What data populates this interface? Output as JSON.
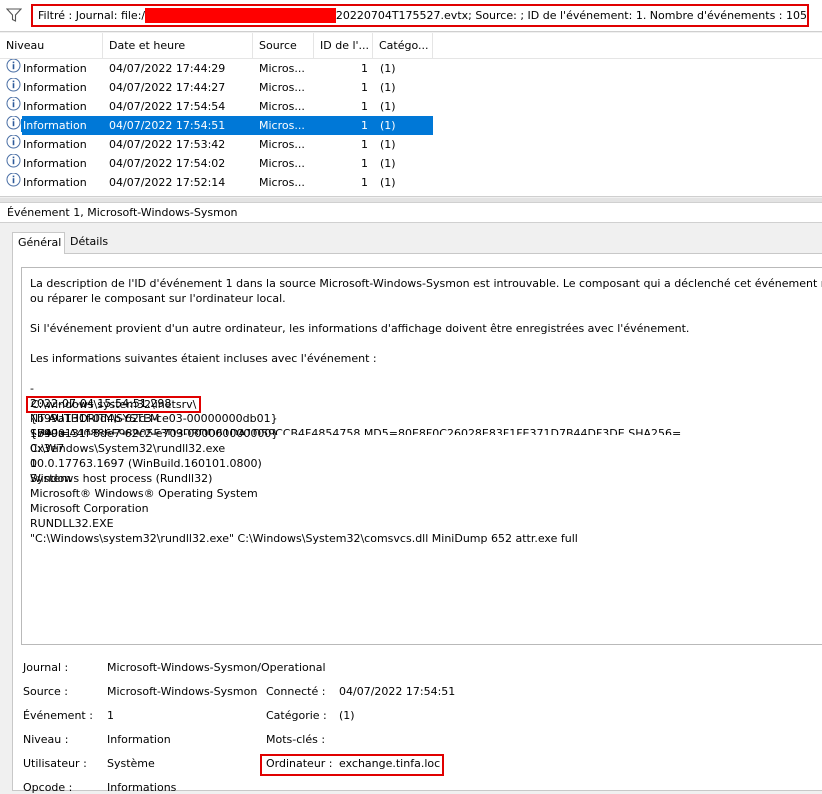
{
  "filter": {
    "prefix": "Filtré : Journal: file:/",
    "suffix": "20220704T175527.evtx; Source: ; ID de l'événement: 1. Nombre d'événements : 105"
  },
  "columns": {
    "level": "Niveau",
    "date": "Date et heure",
    "source": "Source",
    "id": "ID de l'...",
    "category": "Catégo..."
  },
  "rows": [
    {
      "level": "Information",
      "date": "04/07/2022 17:44:29",
      "source": "Micros...",
      "id": "1",
      "category": "(1)"
    },
    {
      "level": "Information",
      "date": "04/07/2022 17:44:27",
      "source": "Micros...",
      "id": "1",
      "category": "(1)"
    },
    {
      "level": "Information",
      "date": "04/07/2022 17:54:54",
      "source": "Micros...",
      "id": "1",
      "category": "(1)"
    },
    {
      "level": "Information",
      "date": "04/07/2022 17:54:51",
      "source": "Micros...",
      "id": "1",
      "category": "(1)"
    },
    {
      "level": "Information",
      "date": "04/07/2022 17:53:42",
      "source": "Micros...",
      "id": "1",
      "category": "(1)"
    },
    {
      "level": "Information",
      "date": "04/07/2022 17:54:02",
      "source": "Micros...",
      "id": "1",
      "category": "(1)"
    },
    {
      "level": "Information",
      "date": "04/07/2022 17:52:14",
      "source": "Micros...",
      "id": "1",
      "category": "(1)"
    }
  ],
  "selected_row": 3,
  "event_title": "Événement 1, Microsoft-Windows-Sysmon",
  "tabs": {
    "general": "Général",
    "details": "Détails"
  },
  "description": {
    "line1": "La description de l'ID d'événement 1 dans la source Microsoft-Windows-Sysmon est introuvable. Le composant qui a déclenché cet événement n'est pa",
    "line2": "ou réparer le composant sur l'ordinateur local.",
    "line3": "Si l'événement provient d'un autre ordinateur, les informations d'affichage doivent être enregistrées avec l'événement.",
    "line4": "Les informations suivantes étaient incluses avec l'événement :",
    "values": [
      "-",
      "2022-07-04 15:54:51.298",
      "{b99a131f-0d4b-62c3-ce03-00000000db01}",
      "17400",
      "C:\\Windows\\System32\\rundll32.exe",
      "10.0.17763.1697 (WinBuild.160101.0800)",
      "Windows host process (Rundll32)",
      "Microsoft® Windows® Operating System",
      "Microsoft Corporation",
      "RUNDLL32.EXE",
      "\"C:\\Windows\\system32\\rundll32.exe\" C:\\Windows\\System32\\comsvcs.dll MiniDump 652 attr.exe full"
    ],
    "highlighted": "C:\\windows\\system32\\inetsrv\\",
    "values_after": [
      "NT AUTHORITY\\SYSTEM",
      "{b99a131f-8de7-62c2-e703-000000000000}",
      "0x3e7",
      "0",
      "System"
    ],
    "cut_line": "SHA1=A40886E98905E3D9DBDD61DA1D59CCB4F4854758,MD5=80E8F0C26028E83F1FE371D7B44DF3DE,SHA256="
  },
  "props": {
    "journal_label": "Journal :",
    "journal_value": "Microsoft-Windows-Sysmon/Operational",
    "source_label": "Source :",
    "source_value": "Microsoft-Windows-Sysmon",
    "connected_label": "Connecté :",
    "connected_value": "04/07/2022 17:54:51",
    "event_label": "Événement :",
    "event_value": "1",
    "category_label": "Catégorie :",
    "category_value": "(1)",
    "level_label": "Niveau :",
    "level_value": "Information",
    "keywords_label": "Mots-clés :",
    "user_label": "Utilisateur :",
    "user_value": "Système",
    "computer_label": "Ordinateur :",
    "computer_value": "exchange.tinfa.loc",
    "opcode_label": "Opcode :",
    "opcode_value": "Informations"
  },
  "colors": {
    "selection": "#0078d7",
    "highlight_border": "#e00000",
    "redaction": "#ff0000"
  }
}
